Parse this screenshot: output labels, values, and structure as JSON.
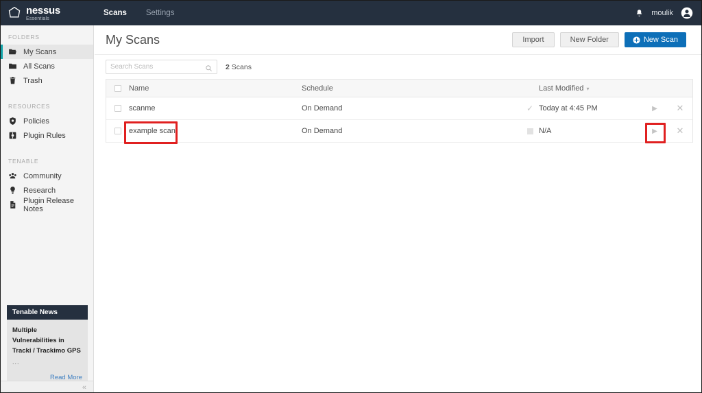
{
  "app": {
    "brand_name": "nessus",
    "brand_sub": "Essentials",
    "brand_icon": "hexagon-logo-icon"
  },
  "topnav": {
    "items": [
      {
        "label": "Scans",
        "active": true
      },
      {
        "label": "Settings",
        "active": false
      }
    ],
    "bell_icon": "bell-icon",
    "username": "moulik",
    "avatar_icon": "user-avatar-icon"
  },
  "sidebar": {
    "groups": [
      {
        "label": "FOLDERS",
        "items": [
          {
            "label": "My Scans",
            "icon": "folder-open-icon",
            "active": true
          },
          {
            "label": "All Scans",
            "icon": "folder-icon",
            "active": false
          },
          {
            "label": "Trash",
            "icon": "trash-icon",
            "active": false
          }
        ]
      },
      {
        "label": "RESOURCES",
        "items": [
          {
            "label": "Policies",
            "icon": "shield-icon",
            "active": false
          },
          {
            "label": "Plugin Rules",
            "icon": "plugin-icon",
            "active": false
          }
        ]
      },
      {
        "label": "TENABLE",
        "items": [
          {
            "label": "Community",
            "icon": "community-icon",
            "active": false
          },
          {
            "label": "Research",
            "icon": "research-bulb-icon",
            "active": false
          },
          {
            "label": "Plugin Release Notes",
            "icon": "document-icon",
            "active": false
          }
        ]
      }
    ],
    "news": {
      "header": "Tenable News",
      "title_line1": "Multiple",
      "title_line2": "Vulnerabilities in",
      "title_line3": "Tracki / Trackimo GPS",
      "dots": "...",
      "read_more": "Read More"
    },
    "collapse_icon": "chevron-double-left-icon",
    "collapse_glyph": "«"
  },
  "main": {
    "page_title": "My Scans",
    "actions": {
      "import_label": "Import",
      "new_folder_label": "New Folder",
      "new_scan_label": "New Scan",
      "new_scan_icon": "plus-circle-icon"
    },
    "search": {
      "placeholder": "Search Scans",
      "value": "",
      "icon": "search-icon"
    },
    "count_number": "2",
    "count_label": "Scans",
    "table": {
      "columns": {
        "name": "Name",
        "schedule": "Schedule",
        "last_modified": "Last Modified",
        "sort_caret": "▾"
      },
      "rows": [
        {
          "name": "scanme",
          "schedule": "On Demand",
          "status_icon": "check-icon",
          "status_glyph": "✓",
          "last_modified": "Today at 4:45 PM",
          "play_icon": "play-icon",
          "play_glyph": "▶",
          "delete_icon": "close-icon",
          "delete_glyph": "✕"
        },
        {
          "name": "example scan",
          "schedule": "On Demand",
          "status_icon": "square-icon",
          "status_glyph": "",
          "last_modified": "N/A",
          "play_icon": "play-icon",
          "play_glyph": "▶",
          "delete_icon": "close-icon",
          "delete_glyph": "✕"
        }
      ]
    }
  },
  "annotations": {
    "accent_color": "#e02020",
    "boxes": [
      {
        "name": "highlight-example-scan-name"
      },
      {
        "name": "highlight-example-scan-launch"
      }
    ]
  },
  "colors": {
    "topbar": "#25303f",
    "sidebar": "#f4f4f4",
    "active_accent": "#12a3a8",
    "primary_button": "#0d6fb8",
    "link": "#3e7fc1"
  }
}
